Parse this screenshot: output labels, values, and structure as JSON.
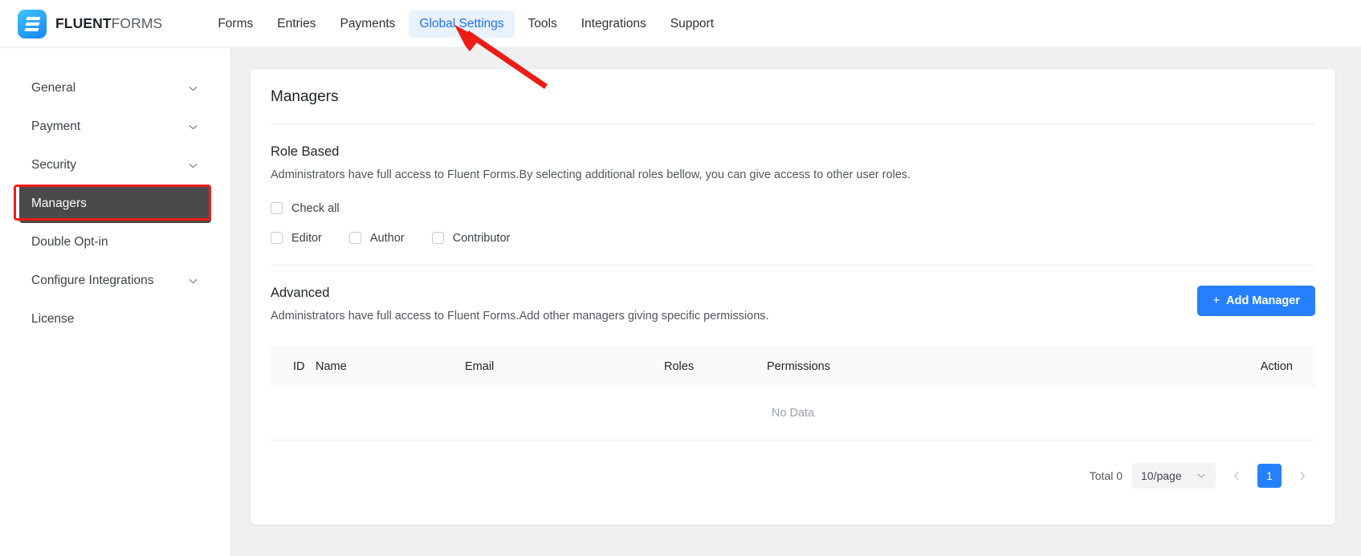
{
  "header": {
    "logo_bold": "FLUENT",
    "logo_light": "FORMS",
    "nav": [
      {
        "label": "Forms",
        "active": false
      },
      {
        "label": "Entries",
        "active": false
      },
      {
        "label": "Payments",
        "active": false
      },
      {
        "label": "Global Settings",
        "active": true
      },
      {
        "label": "Tools",
        "active": false
      },
      {
        "label": "Integrations",
        "active": false
      },
      {
        "label": "Support",
        "active": false
      }
    ]
  },
  "sidebar": {
    "items": [
      {
        "label": "General",
        "expandable": true,
        "selected": false
      },
      {
        "label": "Payment",
        "expandable": true,
        "selected": false
      },
      {
        "label": "Security",
        "expandable": true,
        "selected": false
      },
      {
        "label": "Managers",
        "expandable": false,
        "selected": true
      },
      {
        "label": "Double Opt-in",
        "expandable": false,
        "selected": false
      },
      {
        "label": "Configure Integrations",
        "expandable": true,
        "selected": false
      },
      {
        "label": "License",
        "expandable": false,
        "selected": false
      }
    ]
  },
  "panel": {
    "title": "Managers",
    "role_based": {
      "title": "Role Based",
      "description": "Administrators have full access to Fluent Forms.By selecting additional roles bellow, you can give access to other user roles.",
      "check_all_label": "Check all",
      "check_all_checked": false,
      "roles": [
        {
          "label": "Editor",
          "checked": false
        },
        {
          "label": "Author",
          "checked": false
        },
        {
          "label": "Contributor",
          "checked": false
        }
      ]
    },
    "advanced": {
      "title": "Advanced",
      "description": "Administrators have full access to Fluent Forms.Add other managers giving specific permissions.",
      "add_button_icon": "plus-icon",
      "add_button_label": "Add Manager"
    },
    "table": {
      "columns": [
        "ID",
        "Name",
        "Email",
        "Roles",
        "Permissions",
        "Action"
      ],
      "rows": [],
      "empty_text": "No Data"
    },
    "pagination": {
      "total_label": "Total 0",
      "page_size": "10/page",
      "prev_icon": "chevron-left-icon",
      "next_icon": "chevron-right-icon",
      "current_page": "1"
    }
  },
  "annotations": {
    "arrow_color": "#ee1c16",
    "highlight_color": "#ef1b18"
  }
}
